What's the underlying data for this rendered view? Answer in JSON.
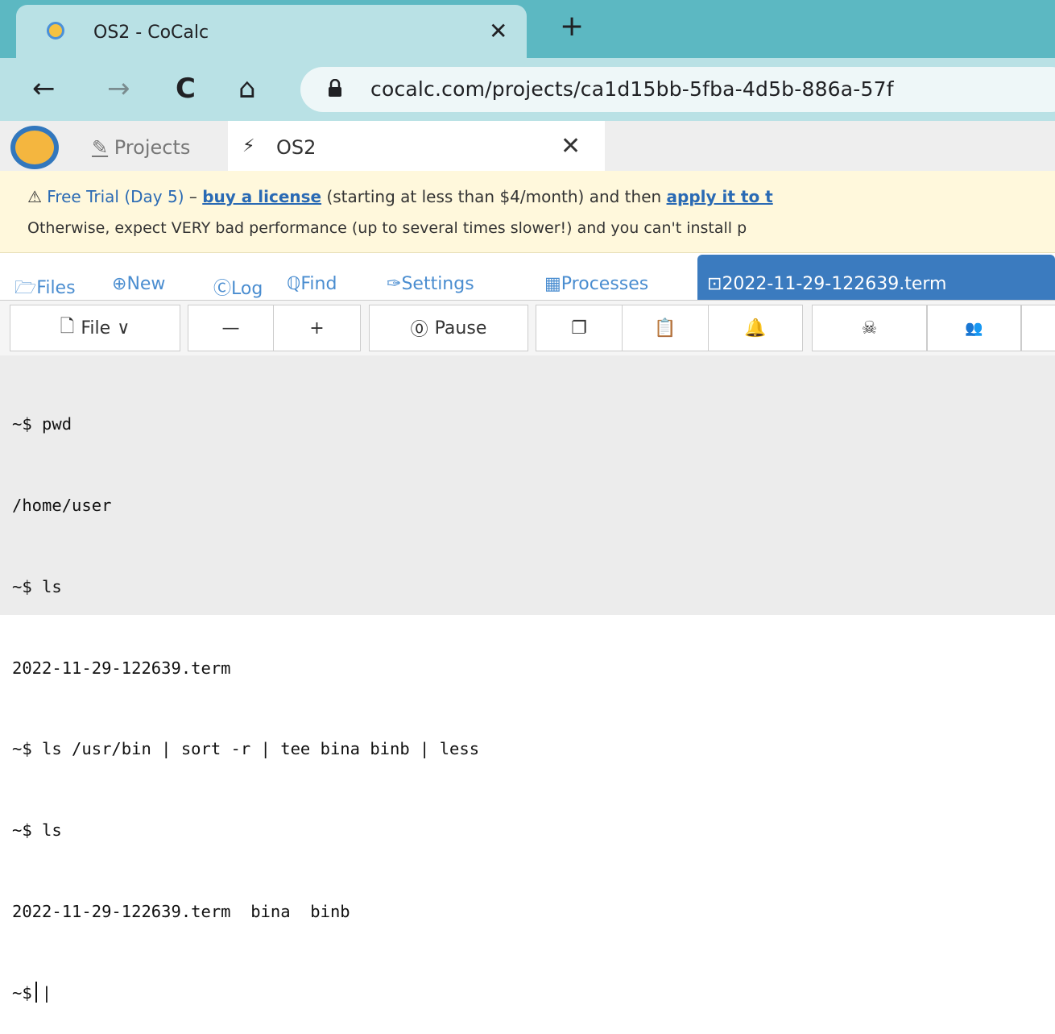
{
  "browser": {
    "tab_title": "OS2 - CoCalc",
    "tab_close": "✕",
    "new_tab": "+",
    "nav": {
      "back": "←",
      "forward": "→",
      "reload": "C",
      "home": "⌂"
    },
    "url": "cocalc.com/projects/ca1d15bb-5fba-4d5b-886a-57f"
  },
  "cocalc": {
    "projects_label": "Projects",
    "project_tab_label": "OS2",
    "project_tab_close": "✕"
  },
  "banner": {
    "warning_symbol": "⚠",
    "trial_text": "Free Trial (Day 5)",
    "dash": " – ",
    "buy_link": "buy a license",
    "middle_text": " (starting at less than $4/month) and then ",
    "apply_link": "apply it to t",
    "line2": "Otherwise, expect VERY bad performance (up to several times slower!) and you can't install p"
  },
  "project_nav": {
    "files": "Files",
    "new": "New",
    "log": "Log",
    "find": "Find",
    "settings": "Settings",
    "processes": "Processes",
    "terminal_tab": "2022-11-29-122639.term"
  },
  "editor_toolbar": {
    "file": "File",
    "minus": "—",
    "plus": "+",
    "pause": "Pause"
  },
  "terminal": {
    "lines": [
      "~$ pwd",
      "/home/user",
      "~$ ls",
      "2022-11-29-122639.term",
      "~$ ls /usr/bin | sort -r | tee bina binb | less",
      "~$ ls",
      "2022-11-29-122639.term  bina  binb"
    ],
    "prompt": "~$",
    "trailing": "|"
  }
}
